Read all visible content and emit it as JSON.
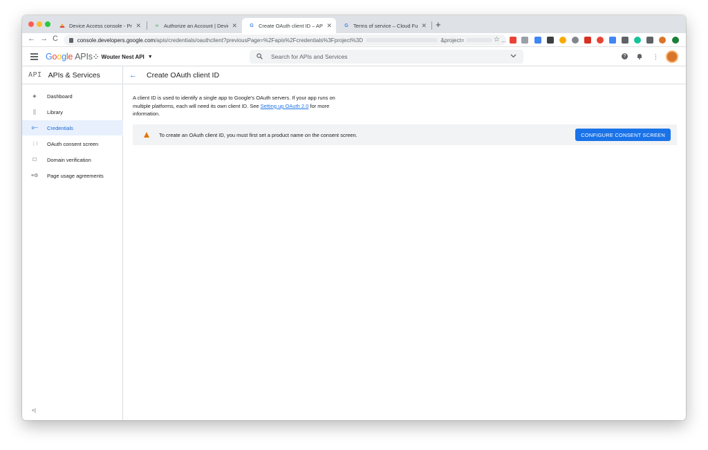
{
  "browser": {
    "tabs": [
      {
        "title": "Device Access console - Proje",
        "favicon": "nest-icon",
        "active": false
      },
      {
        "title": "Authorize an Account | Devic",
        "favicon": "devices-icon",
        "active": false
      },
      {
        "title": "Create OAuth client ID – APIs &",
        "favicon": "google-g-icon",
        "active": true
      },
      {
        "title": "Terms of service – Cloud Funct",
        "favicon": "google-g-icon",
        "active": false
      }
    ],
    "new_tab_label": "+",
    "close_label": "✕",
    "url": {
      "host": "console.developers.google.com",
      "path": "/apis/credentials/oauthclient?previousPage=%2Fapis%2Fcredentials%3Fproject%3D",
      "suffix": "&project=",
      "ellipsis": "..."
    },
    "nav": {
      "back": "←",
      "forward": "→",
      "reload": "C"
    },
    "star": "☆"
  },
  "header": {
    "logo": {
      "g1": "G",
      "g2": "o",
      "g3": "o",
      "g4": "g",
      "g5": "l",
      "g6": "e",
      "apis": "APIs"
    },
    "project": "Wouter Nest API",
    "project_caret": "▼",
    "project_icon": "⁘",
    "search_placeholder": "Search for APIs and Services",
    "help": "?",
    "bell": "🔔",
    "more": "⋮"
  },
  "sidebar": {
    "badge": "API",
    "title": "APIs & Services",
    "items": [
      {
        "label": "Dashboard",
        "icon": "◈",
        "active": false
      },
      {
        "label": "Library",
        "icon": "⣿",
        "active": false
      },
      {
        "label": "Credentials",
        "icon": "o─",
        "active": true
      },
      {
        "label": "OAuth consent screen",
        "icon": "⋮⁝",
        "active": false
      },
      {
        "label": "Domain verification",
        "icon": "☐",
        "active": false
      },
      {
        "label": "Page usage agreements",
        "icon": "≡⚙",
        "active": false
      }
    ],
    "collapse": "<|"
  },
  "main": {
    "back": "←",
    "title": "Create OAuth client ID",
    "description_before": "A client ID is used to identify a single app to Google's OAuth servers. If your app runs on multiple platforms, each will need its own client ID. See ",
    "description_link": "Setting up OAuth 2.0",
    "description_after": " for more information.",
    "warning_text": "To create an OAuth client ID, you must first set a product name on the consent screen.",
    "warning_button": "CONFIGURE CONSENT SCREEN"
  },
  "colors": {
    "accent": "#1a73e8",
    "active_nav_bg": "#e8f0fe",
    "warning": "#e37400"
  }
}
